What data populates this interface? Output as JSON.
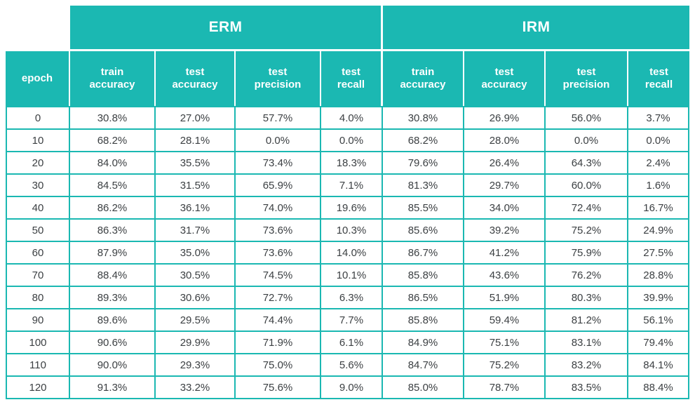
{
  "table": {
    "group_headers": [
      {
        "label": "",
        "span": 1
      },
      {
        "label": "ERM",
        "span": 4
      },
      {
        "label": "IRM",
        "span": 4
      }
    ],
    "column_headers": [
      {
        "line1": "epoch",
        "line2": ""
      },
      {
        "line1": "train",
        "line2": "accuracy"
      },
      {
        "line1": "test",
        "line2": "accuracy"
      },
      {
        "line1": "test",
        "line2": "precision"
      },
      {
        "line1": "test",
        "line2": "recall"
      },
      {
        "line1": "train",
        "line2": "accuracy"
      },
      {
        "line1": "test",
        "line2": "accuracy"
      },
      {
        "line1": "test",
        "line2": "precision"
      },
      {
        "line1": "test",
        "line2": "recall"
      }
    ],
    "rows": [
      [
        "0",
        "30.8%",
        "27.0%",
        "57.7%",
        "4.0%",
        "30.8%",
        "26.9%",
        "56.0%",
        "3.7%"
      ],
      [
        "10",
        "68.2%",
        "28.1%",
        "0.0%",
        "0.0%",
        "68.2%",
        "28.0%",
        "0.0%",
        "0.0%"
      ],
      [
        "20",
        "84.0%",
        "35.5%",
        "73.4%",
        "18.3%",
        "79.6%",
        "26.4%",
        "64.3%",
        "2.4%"
      ],
      [
        "30",
        "84.5%",
        "31.5%",
        "65.9%",
        "7.1%",
        "81.3%",
        "29.7%",
        "60.0%",
        "1.6%"
      ],
      [
        "40",
        "86.2%",
        "36.1%",
        "74.0%",
        "19.6%",
        "85.5%",
        "34.0%",
        "72.4%",
        "16.7%"
      ],
      [
        "50",
        "86.3%",
        "31.7%",
        "73.6%",
        "10.3%",
        "85.6%",
        "39.2%",
        "75.2%",
        "24.9%"
      ],
      [
        "60",
        "87.9%",
        "35.0%",
        "73.6%",
        "14.0%",
        "86.7%",
        "41.2%",
        "75.9%",
        "27.5%"
      ],
      [
        "70",
        "88.4%",
        "30.5%",
        "74.5%",
        "10.1%",
        "85.8%",
        "43.6%",
        "76.2%",
        "28.8%"
      ],
      [
        "80",
        "89.3%",
        "30.6%",
        "72.7%",
        "6.3%",
        "86.5%",
        "51.9%",
        "80.3%",
        "39.9%"
      ],
      [
        "90",
        "89.6%",
        "29.5%",
        "74.4%",
        "7.7%",
        "85.8%",
        "59.4%",
        "81.2%",
        "56.1%"
      ],
      [
        "100",
        "90.6%",
        "29.9%",
        "71.9%",
        "6.1%",
        "84.9%",
        "75.1%",
        "83.1%",
        "79.4%"
      ],
      [
        "110",
        "90.0%",
        "29.3%",
        "75.0%",
        "5.6%",
        "84.7%",
        "75.2%",
        "83.2%",
        "84.1%"
      ],
      [
        "120",
        "91.3%",
        "33.2%",
        "75.6%",
        "9.0%",
        "85.0%",
        "78.7%",
        "83.5%",
        "88.4%"
      ]
    ],
    "colors": {
      "header_background": "#1BB8B2",
      "header_text": "#FFFFFF",
      "grid_line": "#1BB8B2",
      "body_text": "#3C4043",
      "body_background": "#FFFFFF"
    }
  }
}
